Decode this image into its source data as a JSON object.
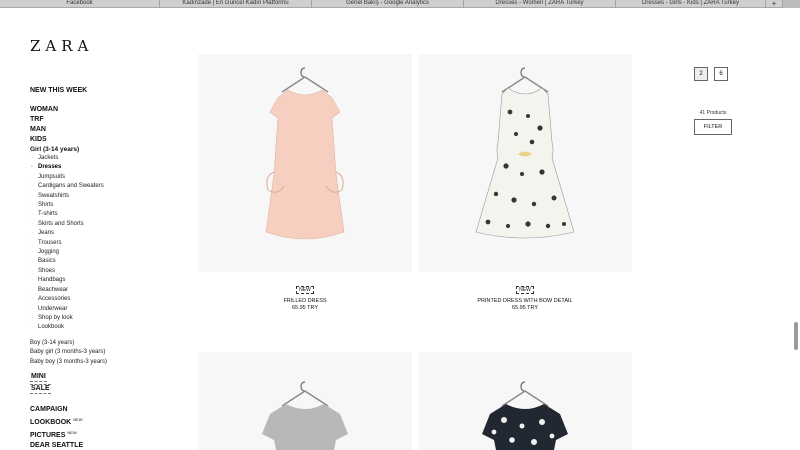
{
  "browser": {
    "tabs": [
      {
        "label": "Facebook"
      },
      {
        "label": "Kadınzade | En Güncel Kadın Platformu"
      },
      {
        "label": "Genel Bakış - Google Analytics"
      },
      {
        "label": "Dresses - Women | ZARA Turkey"
      },
      {
        "label": "Dresses - Girls - Kids | ZARA Turkey"
      }
    ],
    "add_tab": "+"
  },
  "brand": {
    "logo": "ZARA"
  },
  "nav": {
    "new_this_week": "NEW THIS WEEK",
    "main": [
      "WOMAN",
      "TRF",
      "MAN",
      "KIDS"
    ],
    "girl_section": "Girl (3-14 years)",
    "girl_items": [
      "Jackets",
      "Dresses",
      "Jumpsuits",
      "Cardigans and Sweaters",
      "Sweatshirts",
      "Shirts",
      "T-shirts",
      "Skirts and Shorts",
      "Jeans",
      "Trousers",
      "Jogging",
      "Basics",
      "Shoes",
      "Handbags",
      "Beachwear",
      "Accessories",
      "Underwear",
      "Shop by look",
      "Lookbook"
    ],
    "other_kids": [
      "Boy (3-14 years)",
      "Baby girl (3 months-3 years)",
      "Baby boy (3 months-3 years)"
    ],
    "mini": "MINI",
    "sale": "SALE",
    "campaign": "CAMPAIGN",
    "lookbook": "LOOKBOOK",
    "pictures": "PICTURES",
    "new_sup": "NEW",
    "dear_seattle": "DEAR SEATTLE"
  },
  "view_options": [
    "2",
    "6"
  ],
  "products_count": "41 Products",
  "filter_label": "FILTER",
  "products": [
    {
      "badge": "NEW",
      "name": "FRILLED DRESS",
      "price": "65.95 TRY",
      "color": "#f6cfc0"
    },
    {
      "badge": "NEW",
      "name": "PRINTED DRESS WITH BOW DETAIL",
      "price": "65.95 TRY",
      "color": "#f4f4ef"
    },
    {
      "color": "#b8b8b8"
    },
    {
      "color": "#222831"
    }
  ]
}
